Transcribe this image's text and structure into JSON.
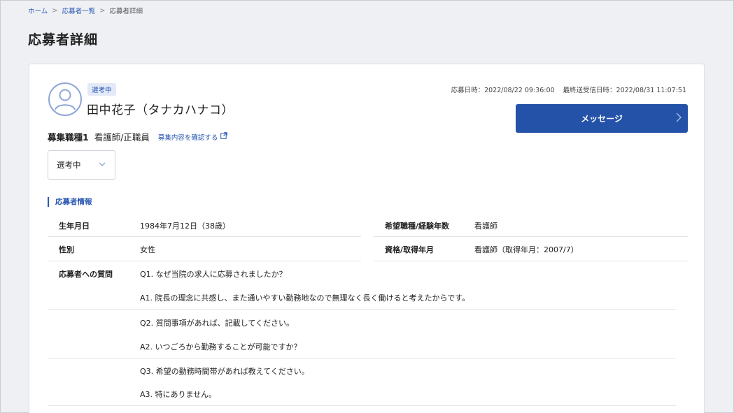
{
  "breadcrumb": {
    "home": "ホーム",
    "list": "応募者一覧",
    "current": "応募者詳細",
    "separator": ">"
  },
  "page": {
    "title": "応募者詳細"
  },
  "applicant": {
    "status_badge": "選考中",
    "name": "田中花子（タナカハナコ）",
    "applied_at": "応募日時：2022/08/22 09:36:00",
    "last_message_at": "最終送受信日時：2022/08/31 11:07:51",
    "message_button_label": "メッセージ",
    "job_label": "募集職種1",
    "job_value": "看護師/正職員",
    "job_link_label": "募集内容を確認する",
    "status_select_value": "選考中"
  },
  "info": {
    "section_title": "応募者情報",
    "birthdate_label": "生年月日",
    "birthdate_value": "1984年7月12日（38歳）",
    "gender_label": "性別",
    "gender_value": "女性",
    "desired_label": "希望職種/経験年数",
    "desired_value": "看護師",
    "license_label": "資格/取得年月",
    "license_value": "看護師（取得年月：2007/7）"
  },
  "qa": {
    "label": "応募者への質問",
    "items": [
      {
        "q": "Q1. なぜ当院の求人に応募されましたか？",
        "a": "A1. 院長の理念に共感し、また通いやすい勤務地なので無理なく長く働けると考えたからです。"
      },
      {
        "q": "Q2. 質問事項があれば、記載してください。",
        "a": "A2. いつごろから勤務することが可能ですか？"
      },
      {
        "q": "Q3. 希望の勤務時間帯があれば教えてください。",
        "a": "A3. 特にありません。"
      }
    ]
  },
  "colors": {
    "accent": "#2452a8",
    "link": "#2b58b2",
    "page_bg": "#eef0f4"
  },
  "icons": {
    "avatar": "user-circle-icon",
    "chevron_right": "chevron-right-icon",
    "chevron_down": "chevron-down-icon",
    "external_link": "external-link-icon"
  }
}
